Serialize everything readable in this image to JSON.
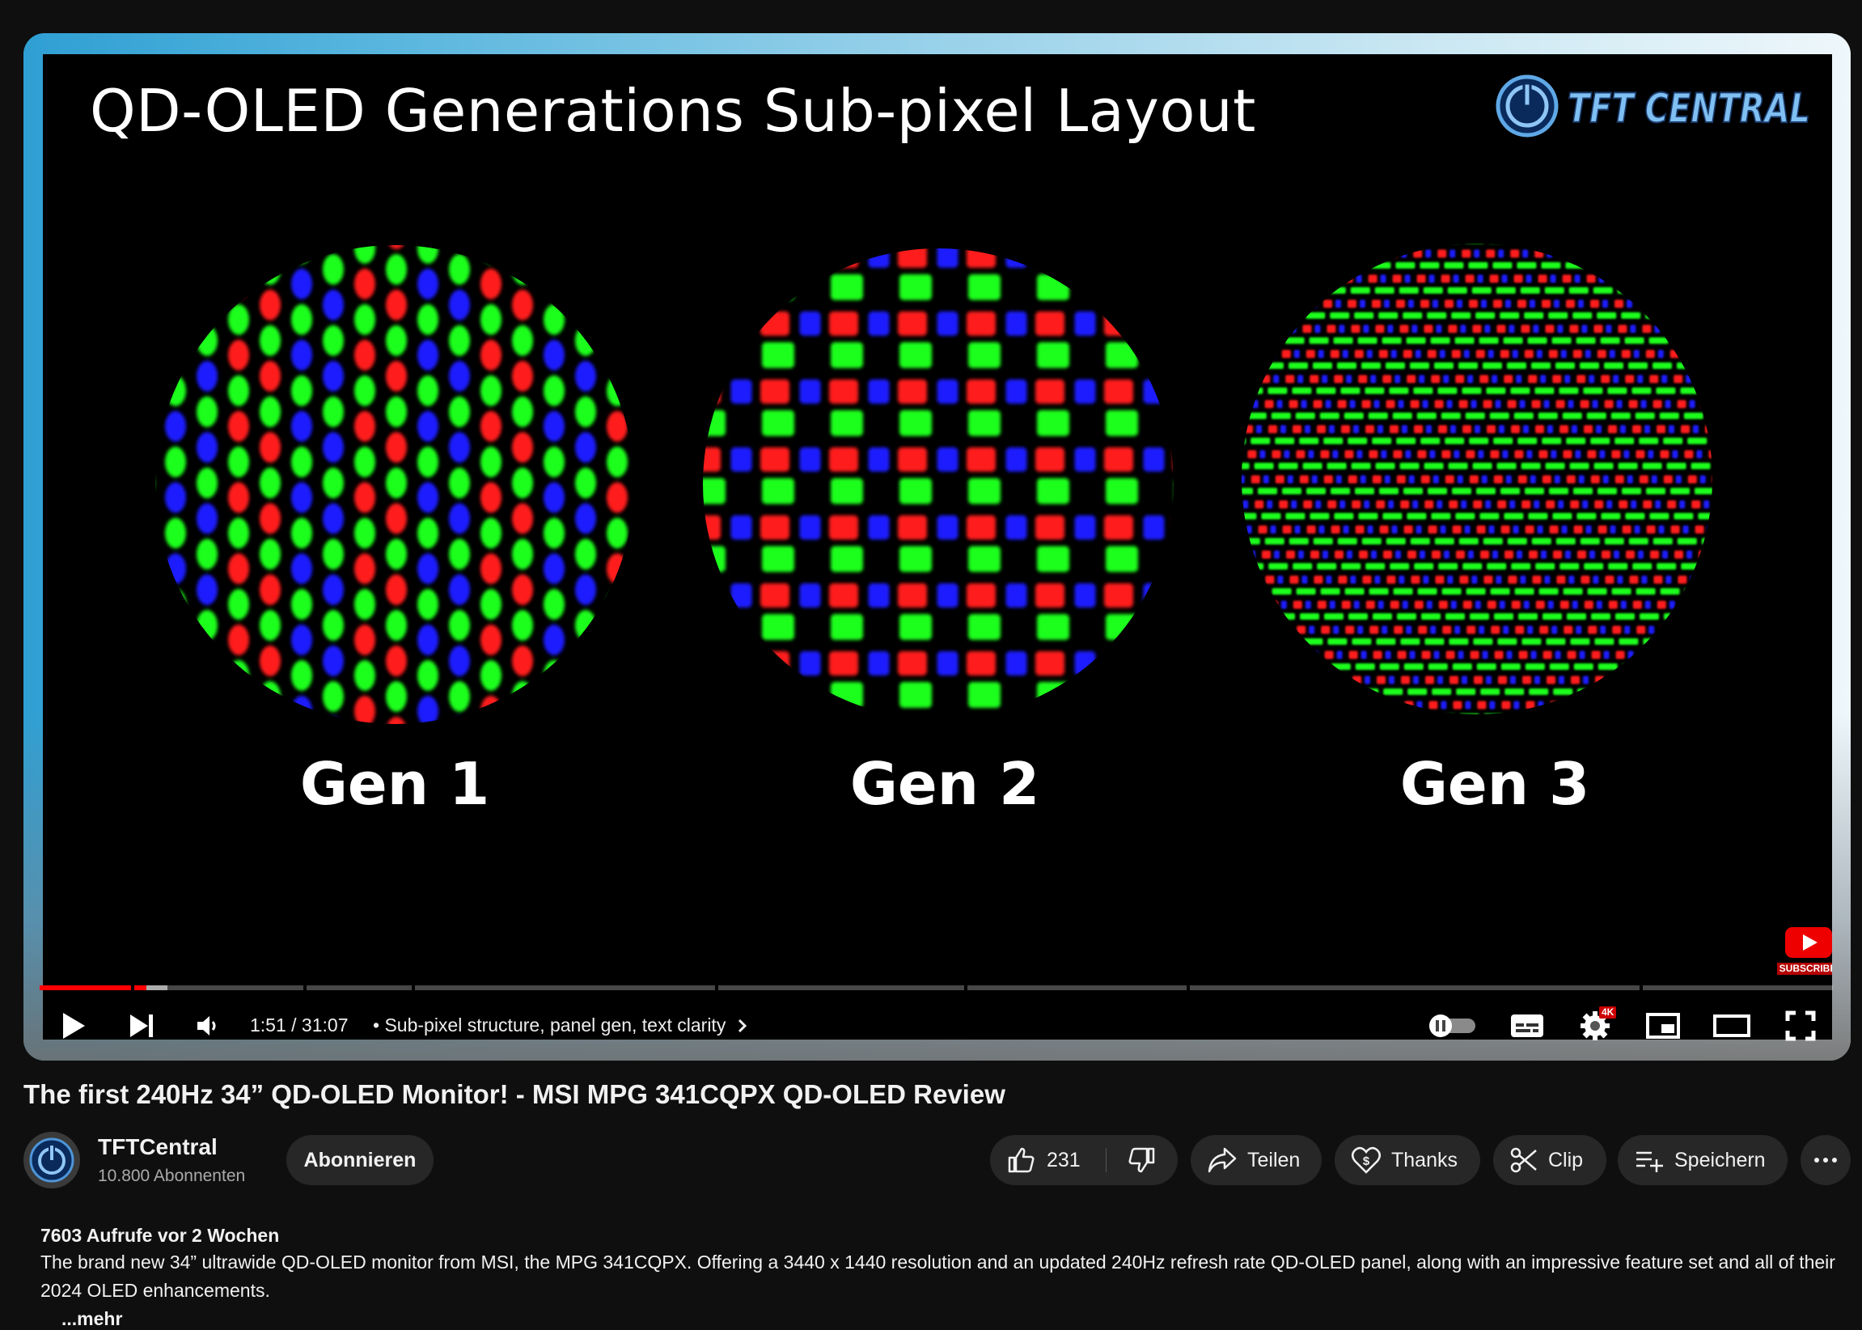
{
  "player": {
    "slide_title": "QD-OLED Generations Sub-pixel Layout",
    "brand_logo_text": "TFT CENTRAL",
    "gen_labels": [
      "Gen 1",
      "Gen 2",
      "Gen 3"
    ],
    "subscribe_watermark": "SUBSCRIBE",
    "time": "1:51 / 31:07",
    "chapter": "• Sub-pixel structure, panel gen, text clarity",
    "quality_badge": "4K",
    "progress_fraction": 0.0595,
    "buffered_fraction": 0.0713
  },
  "video": {
    "title": "The first 240Hz 34” QD-OLED Monitor! - MSI MPG 341CQPX QD-OLED Review"
  },
  "channel": {
    "name": "TFTCentral",
    "subscribers": "10.800 Abonnenten",
    "subscribe_label": "Abonnieren"
  },
  "actions": {
    "likes": "231",
    "share": "Teilen",
    "thanks": "Thanks",
    "clip": "Clip",
    "save": "Speichern",
    "more": "..."
  },
  "description": {
    "meta": "7603 Aufrufe  vor 2 Wochen",
    "text": "The brand new 34” ultrawide QD-OLED monitor from MSI, the MPG 341CQPX. Offering a 3440 x 1440 resolution and an updated 240Hz refresh rate QD-OLED panel, along with an impressive feature set and all of their 2024 OLED enhancements.",
    "more": "...mehr"
  },
  "colors": {
    "red": "#ff1a1a",
    "green": "#1aff1a",
    "blue": "#1a1aff",
    "progress": "#ff0000",
    "accent_blue": "#2f9fd3"
  },
  "icons": [
    "play-icon",
    "next-icon",
    "volume-icon",
    "chevron-right-icon",
    "autoplay-toggle-icon",
    "subtitles-icon",
    "settings-icon",
    "miniplayer-icon",
    "theater-mode-icon",
    "fullscreen-icon",
    "thumbs-up-icon",
    "thumbs-down-icon",
    "share-icon",
    "thanks-icon",
    "clip-icon",
    "save-playlist-icon",
    "more-icon"
  ]
}
